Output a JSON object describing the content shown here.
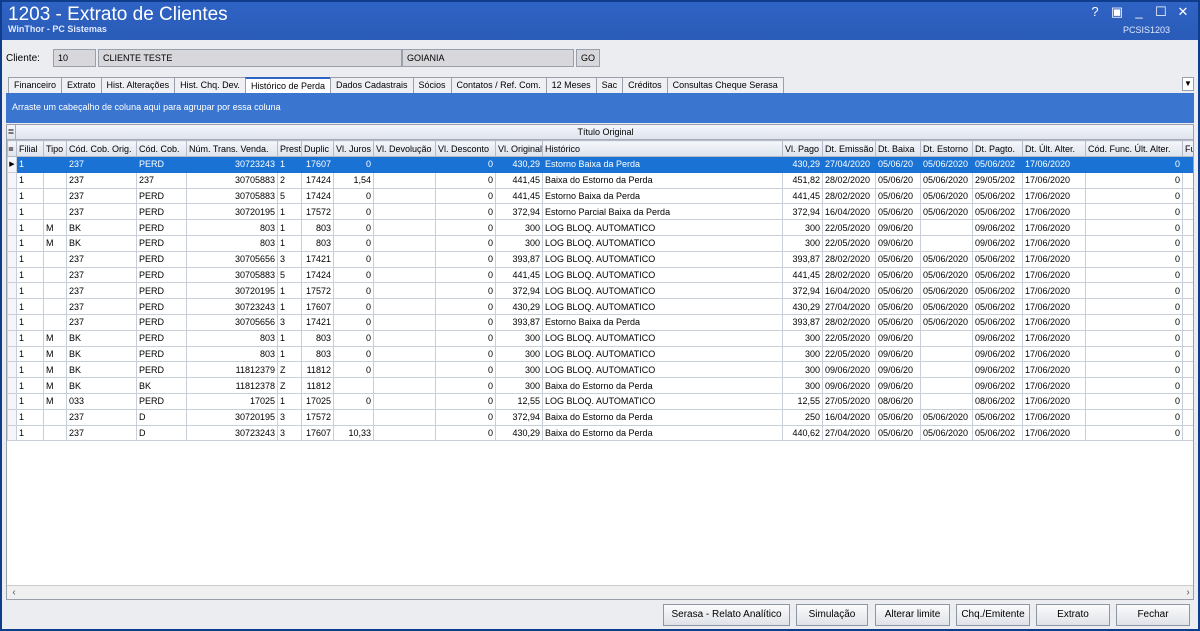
{
  "window": {
    "title": "1203 - Extrato de Clientes",
    "subtitle": "WinThor - PC Sistemas",
    "code": "PCSIS1203",
    "controls": [
      "?",
      "▣",
      "_",
      "☐",
      "✕"
    ]
  },
  "client": {
    "label": "Cliente:",
    "code": "10",
    "name": "CLIENTE TESTE",
    "city": "GOIANIA",
    "state": "GO"
  },
  "tabs": [
    "Financeiro",
    "Extrato",
    "Hist. Alterações",
    "Hist. Chq. Dev.",
    "Histórico de Perda",
    "Dados Cadastrais",
    "Sócios",
    "Contatos / Ref. Com.",
    "12 Meses",
    "Sac",
    "Créditos",
    "Consultas Cheque Serasa"
  ],
  "active_tab": "Histórico de Perda",
  "group_hint": "Arraste um cabeçalho de coluna aqui para agrupar por essa coluna",
  "band_label": "Título Original",
  "columns": [
    "Filial",
    "Tipo",
    "Cód. Cob. Orig.",
    "Cód. Cob.",
    "Núm. Trans. Venda.",
    "Prest",
    "Duplic",
    "Vl. Juros",
    "Vl. Devolução",
    "Vl. Desconto",
    "Vl. Original",
    "Histórico",
    "Vl. Pago",
    "Dt. Emissão",
    "Dt. Baixa",
    "Dt. Estorno",
    "Dt. Pagto.",
    "Dt. Últ. Alter.",
    "Cód. Func. Últ. Alter.",
    "Fur"
  ],
  "rows": [
    [
      "1",
      "",
      "237",
      "PERD",
      "30723243",
      "1",
      "17607",
      "0",
      "",
      "0",
      "430,29",
      "Estorno Baixa da Perda",
      "430,29",
      "27/04/2020",
      "05/06/20",
      "05/06/2020",
      "05/06/202",
      "17/06/2020",
      "0",
      ""
    ],
    [
      "1",
      "",
      "237",
      "237",
      "30705883",
      "2",
      "17424",
      "1,54",
      "",
      "0",
      "441,45",
      "Baixa do Estorno da Perda",
      "451,82",
      "28/02/2020",
      "05/06/20",
      "05/06/2020",
      "29/05/202",
      "17/06/2020",
      "0",
      ""
    ],
    [
      "1",
      "",
      "237",
      "PERD",
      "30705883",
      "5",
      "17424",
      "0",
      "",
      "0",
      "441,45",
      "Estorno Baixa da Perda",
      "441,45",
      "28/02/2020",
      "05/06/20",
      "05/06/2020",
      "05/06/202",
      "17/06/2020",
      "0",
      ""
    ],
    [
      "1",
      "",
      "237",
      "PERD",
      "30720195",
      "1",
      "17572",
      "0",
      "",
      "0",
      "372,94",
      "Estorno Parcial Baixa da Perda",
      "372,94",
      "16/04/2020",
      "05/06/20",
      "05/06/2020",
      "05/06/202",
      "17/06/2020",
      "0",
      ""
    ],
    [
      "1",
      "M",
      "BK",
      "PERD",
      "803",
      "1",
      "803",
      "0",
      "",
      "0",
      "300",
      "LOG BLOQ. AUTOMATICO",
      "300",
      "22/05/2020",
      "09/06/20",
      "",
      "09/06/202",
      "17/06/2020",
      "0",
      ""
    ],
    [
      "1",
      "M",
      "BK",
      "PERD",
      "803",
      "1",
      "803",
      "0",
      "",
      "0",
      "300",
      "LOG BLOQ. AUTOMATICO",
      "300",
      "22/05/2020",
      "09/06/20",
      "",
      "09/06/202",
      "17/06/2020",
      "0",
      ""
    ],
    [
      "1",
      "",
      "237",
      "PERD",
      "30705656",
      "3",
      "17421",
      "0",
      "",
      "0",
      "393,87",
      "LOG BLOQ. AUTOMATICO",
      "393,87",
      "28/02/2020",
      "05/06/20",
      "05/06/2020",
      "05/06/202",
      "17/06/2020",
      "0",
      ""
    ],
    [
      "1",
      "",
      "237",
      "PERD",
      "30705883",
      "5",
      "17424",
      "0",
      "",
      "0",
      "441,45",
      "LOG BLOQ. AUTOMATICO",
      "441,45",
      "28/02/2020",
      "05/06/20",
      "05/06/2020",
      "05/06/202",
      "17/06/2020",
      "0",
      ""
    ],
    [
      "1",
      "",
      "237",
      "PERD",
      "30720195",
      "1",
      "17572",
      "0",
      "",
      "0",
      "372,94",
      "LOG BLOQ. AUTOMATICO",
      "372,94",
      "16/04/2020",
      "05/06/20",
      "05/06/2020",
      "05/06/202",
      "17/06/2020",
      "0",
      ""
    ],
    [
      "1",
      "",
      "237",
      "PERD",
      "30723243",
      "1",
      "17607",
      "0",
      "",
      "0",
      "430,29",
      "LOG BLOQ. AUTOMATICO",
      "430,29",
      "27/04/2020",
      "05/06/20",
      "05/06/2020",
      "05/06/202",
      "17/06/2020",
      "0",
      ""
    ],
    [
      "1",
      "",
      "237",
      "PERD",
      "30705656",
      "3",
      "17421",
      "0",
      "",
      "0",
      "393,87",
      "Estorno Baixa da Perda",
      "393,87",
      "28/02/2020",
      "05/06/20",
      "05/06/2020",
      "05/06/202",
      "17/06/2020",
      "0",
      ""
    ],
    [
      "1",
      "M",
      "BK",
      "PERD",
      "803",
      "1",
      "803",
      "0",
      "",
      "0",
      "300",
      "LOG BLOQ. AUTOMATICO",
      "300",
      "22/05/2020",
      "09/06/20",
      "",
      "09/06/202",
      "17/06/2020",
      "0",
      ""
    ],
    [
      "1",
      "M",
      "BK",
      "PERD",
      "803",
      "1",
      "803",
      "0",
      "",
      "0",
      "300",
      "LOG BLOQ. AUTOMATICO",
      "300",
      "22/05/2020",
      "09/06/20",
      "",
      "09/06/202",
      "17/06/2020",
      "0",
      ""
    ],
    [
      "1",
      "M",
      "BK",
      "PERD",
      "11812379",
      "Z",
      "11812",
      "0",
      "",
      "0",
      "300",
      "LOG BLOQ. AUTOMATICO",
      "300",
      "09/06/2020",
      "09/06/20",
      "",
      "09/06/202",
      "17/06/2020",
      "0",
      ""
    ],
    [
      "1",
      "M",
      "BK",
      "BK",
      "11812378",
      "Z",
      "11812",
      "",
      "",
      "0",
      "300",
      "Baixa do Estorno da Perda",
      "300",
      "09/06/2020",
      "09/06/20",
      "",
      "09/06/202",
      "17/06/2020",
      "0",
      ""
    ],
    [
      "1",
      "M",
      "033",
      "PERD",
      "17025",
      "1",
      "17025",
      "0",
      "",
      "0",
      "12,55",
      "LOG BLOQ. AUTOMATICO",
      "12,55",
      "27/05/2020",
      "08/06/20",
      "",
      "08/06/202",
      "17/06/2020",
      "0",
      ""
    ],
    [
      "1",
      "",
      "237",
      "D",
      "30720195",
      "3",
      "17572",
      "",
      "",
      "0",
      "372,94",
      "Baixa do Estorno da Perda",
      "250",
      "16/04/2020",
      "05/06/20",
      "05/06/2020",
      "05/06/202",
      "17/06/2020",
      "0",
      ""
    ],
    [
      "1",
      "",
      "237",
      "D",
      "30723243",
      "3",
      "17607",
      "10,33",
      "",
      "0",
      "430,29",
      "Baixa do Estorno da Perda",
      "440,62",
      "27/04/2020",
      "05/06/20",
      "05/06/2020",
      "05/06/202",
      "17/06/2020",
      "0",
      ""
    ]
  ],
  "selected_row": 0,
  "buttons": {
    "serasa": "Serasa - Relato Analítico",
    "simulacao": "Simulação",
    "alterar_limite": "Alterar limite",
    "chq_emitente": "Chq./Emitente",
    "extrato": "Extrato",
    "fechar": "Fechar"
  }
}
